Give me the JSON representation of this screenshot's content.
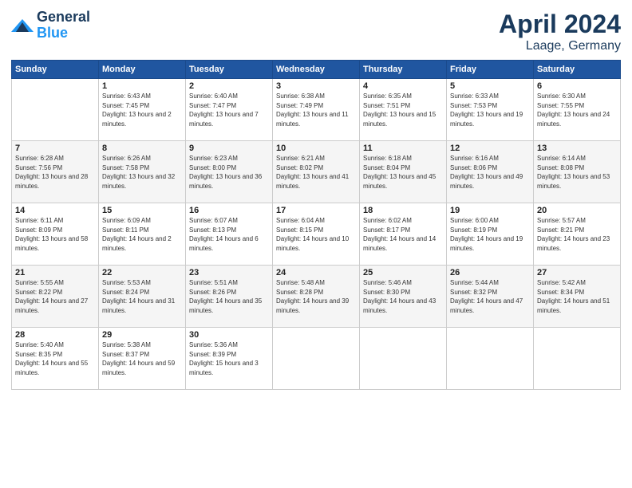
{
  "header": {
    "logo": "GeneralBlue",
    "month": "April 2024",
    "location": "Laage, Germany"
  },
  "weekdays": [
    "Sunday",
    "Monday",
    "Tuesday",
    "Wednesday",
    "Thursday",
    "Friday",
    "Saturday"
  ],
  "weeks": [
    [
      {
        "day": null
      },
      {
        "day": "1",
        "sunrise": "6:43 AM",
        "sunset": "7:45 PM",
        "daylight": "13 hours and 2 minutes."
      },
      {
        "day": "2",
        "sunrise": "6:40 AM",
        "sunset": "7:47 PM",
        "daylight": "13 hours and 7 minutes."
      },
      {
        "day": "3",
        "sunrise": "6:38 AM",
        "sunset": "7:49 PM",
        "daylight": "13 hours and 11 minutes."
      },
      {
        "day": "4",
        "sunrise": "6:35 AM",
        "sunset": "7:51 PM",
        "daylight": "13 hours and 15 minutes."
      },
      {
        "day": "5",
        "sunrise": "6:33 AM",
        "sunset": "7:53 PM",
        "daylight": "13 hours and 19 minutes."
      },
      {
        "day": "6",
        "sunrise": "6:30 AM",
        "sunset": "7:55 PM",
        "daylight": "13 hours and 24 minutes."
      }
    ],
    [
      {
        "day": "7",
        "sunrise": "6:28 AM",
        "sunset": "7:56 PM",
        "daylight": "13 hours and 28 minutes."
      },
      {
        "day": "8",
        "sunrise": "6:26 AM",
        "sunset": "7:58 PM",
        "daylight": "13 hours and 32 minutes."
      },
      {
        "day": "9",
        "sunrise": "6:23 AM",
        "sunset": "8:00 PM",
        "daylight": "13 hours and 36 minutes."
      },
      {
        "day": "10",
        "sunrise": "6:21 AM",
        "sunset": "8:02 PM",
        "daylight": "13 hours and 41 minutes."
      },
      {
        "day": "11",
        "sunrise": "6:18 AM",
        "sunset": "8:04 PM",
        "daylight": "13 hours and 45 minutes."
      },
      {
        "day": "12",
        "sunrise": "6:16 AM",
        "sunset": "8:06 PM",
        "daylight": "13 hours and 49 minutes."
      },
      {
        "day": "13",
        "sunrise": "6:14 AM",
        "sunset": "8:08 PM",
        "daylight": "13 hours and 53 minutes."
      }
    ],
    [
      {
        "day": "14",
        "sunrise": "6:11 AM",
        "sunset": "8:09 PM",
        "daylight": "13 hours and 58 minutes."
      },
      {
        "day": "15",
        "sunrise": "6:09 AM",
        "sunset": "8:11 PM",
        "daylight": "14 hours and 2 minutes."
      },
      {
        "day": "16",
        "sunrise": "6:07 AM",
        "sunset": "8:13 PM",
        "daylight": "14 hours and 6 minutes."
      },
      {
        "day": "17",
        "sunrise": "6:04 AM",
        "sunset": "8:15 PM",
        "daylight": "14 hours and 10 minutes."
      },
      {
        "day": "18",
        "sunrise": "6:02 AM",
        "sunset": "8:17 PM",
        "daylight": "14 hours and 14 minutes."
      },
      {
        "day": "19",
        "sunrise": "6:00 AM",
        "sunset": "8:19 PM",
        "daylight": "14 hours and 19 minutes."
      },
      {
        "day": "20",
        "sunrise": "5:57 AM",
        "sunset": "8:21 PM",
        "daylight": "14 hours and 23 minutes."
      }
    ],
    [
      {
        "day": "21",
        "sunrise": "5:55 AM",
        "sunset": "8:22 PM",
        "daylight": "14 hours and 27 minutes."
      },
      {
        "day": "22",
        "sunrise": "5:53 AM",
        "sunset": "8:24 PM",
        "daylight": "14 hours and 31 minutes."
      },
      {
        "day": "23",
        "sunrise": "5:51 AM",
        "sunset": "8:26 PM",
        "daylight": "14 hours and 35 minutes."
      },
      {
        "day": "24",
        "sunrise": "5:48 AM",
        "sunset": "8:28 PM",
        "daylight": "14 hours and 39 minutes."
      },
      {
        "day": "25",
        "sunrise": "5:46 AM",
        "sunset": "8:30 PM",
        "daylight": "14 hours and 43 minutes."
      },
      {
        "day": "26",
        "sunrise": "5:44 AM",
        "sunset": "8:32 PM",
        "daylight": "14 hours and 47 minutes."
      },
      {
        "day": "27",
        "sunrise": "5:42 AM",
        "sunset": "8:34 PM",
        "daylight": "14 hours and 51 minutes."
      }
    ],
    [
      {
        "day": "28",
        "sunrise": "5:40 AM",
        "sunset": "8:35 PM",
        "daylight": "14 hours and 55 minutes."
      },
      {
        "day": "29",
        "sunrise": "5:38 AM",
        "sunset": "8:37 PM",
        "daylight": "14 hours and 59 minutes."
      },
      {
        "day": "30",
        "sunrise": "5:36 AM",
        "sunset": "8:39 PM",
        "daylight": "15 hours and 3 minutes."
      },
      {
        "day": null
      },
      {
        "day": null
      },
      {
        "day": null
      },
      {
        "day": null
      }
    ]
  ]
}
